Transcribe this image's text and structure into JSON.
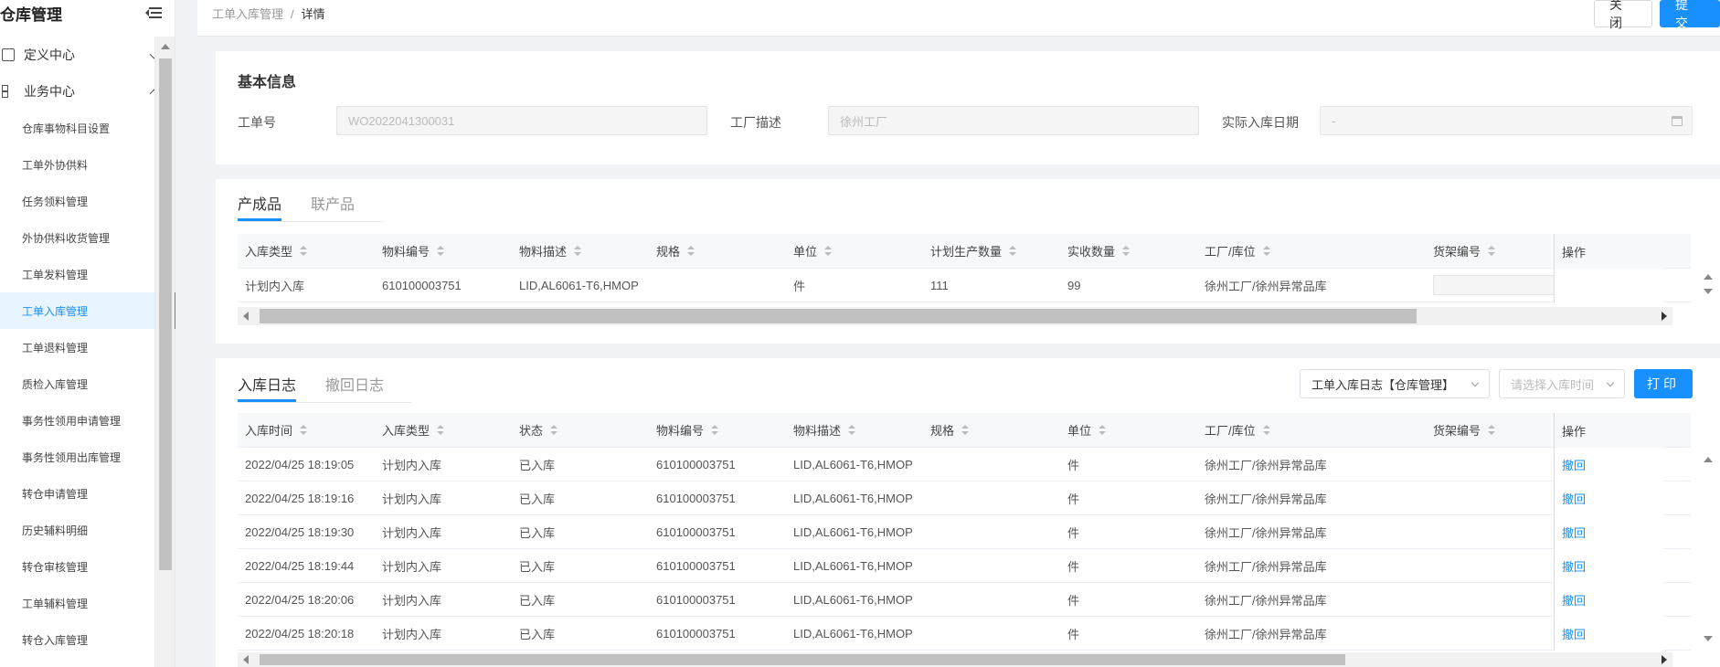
{
  "sidebar": {
    "title": "仓库管理",
    "groups": [
      {
        "label": "定义中心",
        "expanded": false
      },
      {
        "label": "业务中心",
        "expanded": true
      }
    ],
    "items": [
      "仓库事物科目设置",
      "工单外协供料",
      "任务领料管理",
      "外协供料收货管理",
      "工单发料管理",
      "工单入库管理",
      "工单退料管理",
      "质检入库管理",
      "事务性领用申请管理",
      "事务性领用出库管理",
      "转仓申请管理",
      "历史辅料明细",
      "转仓审核管理",
      "工单辅料管理",
      "转仓入库管理"
    ],
    "active_item": "工单入库管理"
  },
  "breadcrumb": {
    "parent": "工单入库管理",
    "separator": "/",
    "current": "详情"
  },
  "actions": {
    "close_label": "关闭",
    "submit_label": "提交"
  },
  "basic_info": {
    "title": "基本信息",
    "fields": [
      {
        "label": "工单号",
        "value": "WO2022041300031"
      },
      {
        "label": "工厂描述",
        "value": "徐州工厂"
      },
      {
        "label": "实际入库日期",
        "value": "-"
      }
    ]
  },
  "product_section": {
    "tabs": [
      "产成品",
      "联产品"
    ],
    "active_tab": "产成品",
    "columns": [
      "入库类型",
      "物料编号",
      "物料描述",
      "规格",
      "单位",
      "计划生产数量",
      "实收数量",
      "工厂/库位",
      "货架编号",
      "操作"
    ],
    "rows": [
      {
        "type": "计划内入库",
        "material_no": "610100003751",
        "material_desc": "LID,AL6061-T6,HMOP",
        "spec": "",
        "unit": "件",
        "plan_qty": "111",
        "received_qty": "99",
        "factory_location": "徐州工厂/徐州异常品库",
        "shelf_no": ""
      }
    ]
  },
  "log_section": {
    "tabs": [
      "入库日志",
      "撤回日志"
    ],
    "active_tab": "入库日志",
    "report_select": "工单入库日志【仓库管理】",
    "time_select_placeholder": "请选择入库时间",
    "print_label": "打印",
    "columns": [
      "入库时间",
      "入库类型",
      "状态",
      "物料编号",
      "物料描述",
      "规格",
      "单位",
      "工厂/库位",
      "货架编号",
      "操作"
    ],
    "rows": [
      {
        "time": "2022/04/25 18:19:05",
        "type": "计划内入库",
        "status": "已入库",
        "material_no": "610100003751",
        "material_desc": "LID,AL6061-T6,HMOP",
        "spec": "",
        "unit": "件",
        "factory_location": "徐州工厂/徐州异常品库",
        "shelf_no": "",
        "action": "撤回"
      },
      {
        "time": "2022/04/25 18:19:16",
        "type": "计划内入库",
        "status": "已入库",
        "material_no": "610100003751",
        "material_desc": "LID,AL6061-T6,HMOP",
        "spec": "",
        "unit": "件",
        "factory_location": "徐州工厂/徐州异常品库",
        "shelf_no": "",
        "action": "撤回"
      },
      {
        "time": "2022/04/25 18:19:30",
        "type": "计划内入库",
        "status": "已入库",
        "material_no": "610100003751",
        "material_desc": "LID,AL6061-T6,HMOP",
        "spec": "",
        "unit": "件",
        "factory_location": "徐州工厂/徐州异常品库",
        "shelf_no": "",
        "action": "撤回"
      },
      {
        "time": "2022/04/25 18:19:44",
        "type": "计划内入库",
        "status": "已入库",
        "material_no": "610100003751",
        "material_desc": "LID,AL6061-T6,HMOP",
        "spec": "",
        "unit": "件",
        "factory_location": "徐州工厂/徐州异常品库",
        "shelf_no": "",
        "action": "撤回"
      },
      {
        "time": "2022/04/25 18:20:06",
        "type": "计划内入库",
        "status": "已入库",
        "material_no": "610100003751",
        "material_desc": "LID,AL6061-T6,HMOP",
        "spec": "",
        "unit": "件",
        "factory_location": "徐州工厂/徐州异常品库",
        "shelf_no": "",
        "action": "撤回"
      },
      {
        "time": "2022/04/25 18:20:18",
        "type": "计划内入库",
        "status": "已入库",
        "material_no": "610100003751",
        "material_desc": "LID,AL6061-T6,HMOP",
        "spec": "",
        "unit": "件",
        "factory_location": "徐州工厂/徐州异常品库",
        "shelf_no": "",
        "action": "撤回"
      }
    ]
  },
  "colors": {
    "primary": "#1890ff",
    "active_bg": "#e8f4ff",
    "page_bg": "#f0f2f5"
  }
}
